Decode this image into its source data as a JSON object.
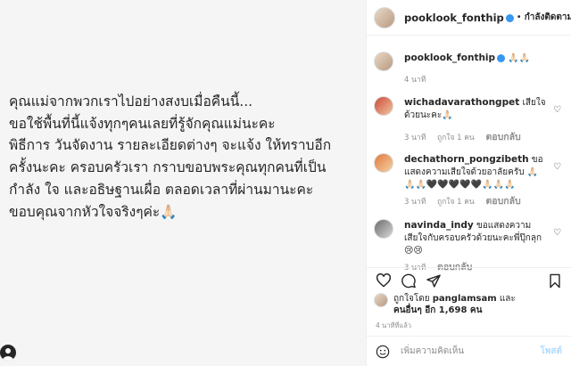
{
  "post": {
    "text": "คุณแม่จากพวกเราไปอย่างสงบเมื่อคืนนี้...\nขอใช้พื้นที่นี้แจ้งทุกๆคนเลยที่รู้จักคุณแม่นะคะ\nพิธีการ วันจัดงาน รายละเอียดต่างๆ จะแจ้ง ให้ทราบอีก\nครั้งนะคะ ครอบครัวเรา กราบขอบพระคุณทุกคนที่เป็น\nกำลัง ใจ และอธิษฐานเผื่อ ตลอดเวลาที่ผ่านมานะคะ\nขอบคุณจากหัวใจจริงๆค่ะ🙏🏻"
  },
  "header": {
    "username": "pooklook_fonthip",
    "follow_label": "กำลังติดตาม",
    "more": "···"
  },
  "caption": {
    "username": "pooklook_fonthip",
    "text": "🙏🏻🙏🏻",
    "time": "4 นาที"
  },
  "comments": [
    {
      "username": "wichadavarathongpet",
      "text": "เสียใจด้วยนะคะ🙏🏻",
      "time": "3 นาที",
      "likes": "ถูกใจ 1 คน",
      "reply": "ตอบกลับ"
    },
    {
      "username": "dechathorn_pongzibeth",
      "text": "ขอแสดงความเสียใจด้วยอาลัยครับ 🙏🏻🙏🏻🙏🏻🖤🖤🖤🖤🖤🙏🏻🙏🏻🙏🏻",
      "time": "3 นาที",
      "likes": "ถูกใจ 1 คน",
      "reply": "ตอบกลับ"
    },
    {
      "username": "navinda_indy",
      "text": "ขอแสดงความเสียใจกับครอบครัวด้วยนะคะพี่ปุ๊กลุก😢😢",
      "time": "3 นาที",
      "reply": "ตอบกลับ"
    }
  ],
  "likes": {
    "line1_prefix": "ถูกใจโดย",
    "liker": "panglamsam",
    "line1_suffix": "และ",
    "line2_prefix": "คนอื่นๆ อีก",
    "count": "1,698",
    "line2_suffix": "คน"
  },
  "time_ago": "4 นาทีที่แล้ว",
  "add_comment": {
    "placeholder": "เพิ่มความคิดเห็น",
    "post_label": "โพสต์"
  }
}
